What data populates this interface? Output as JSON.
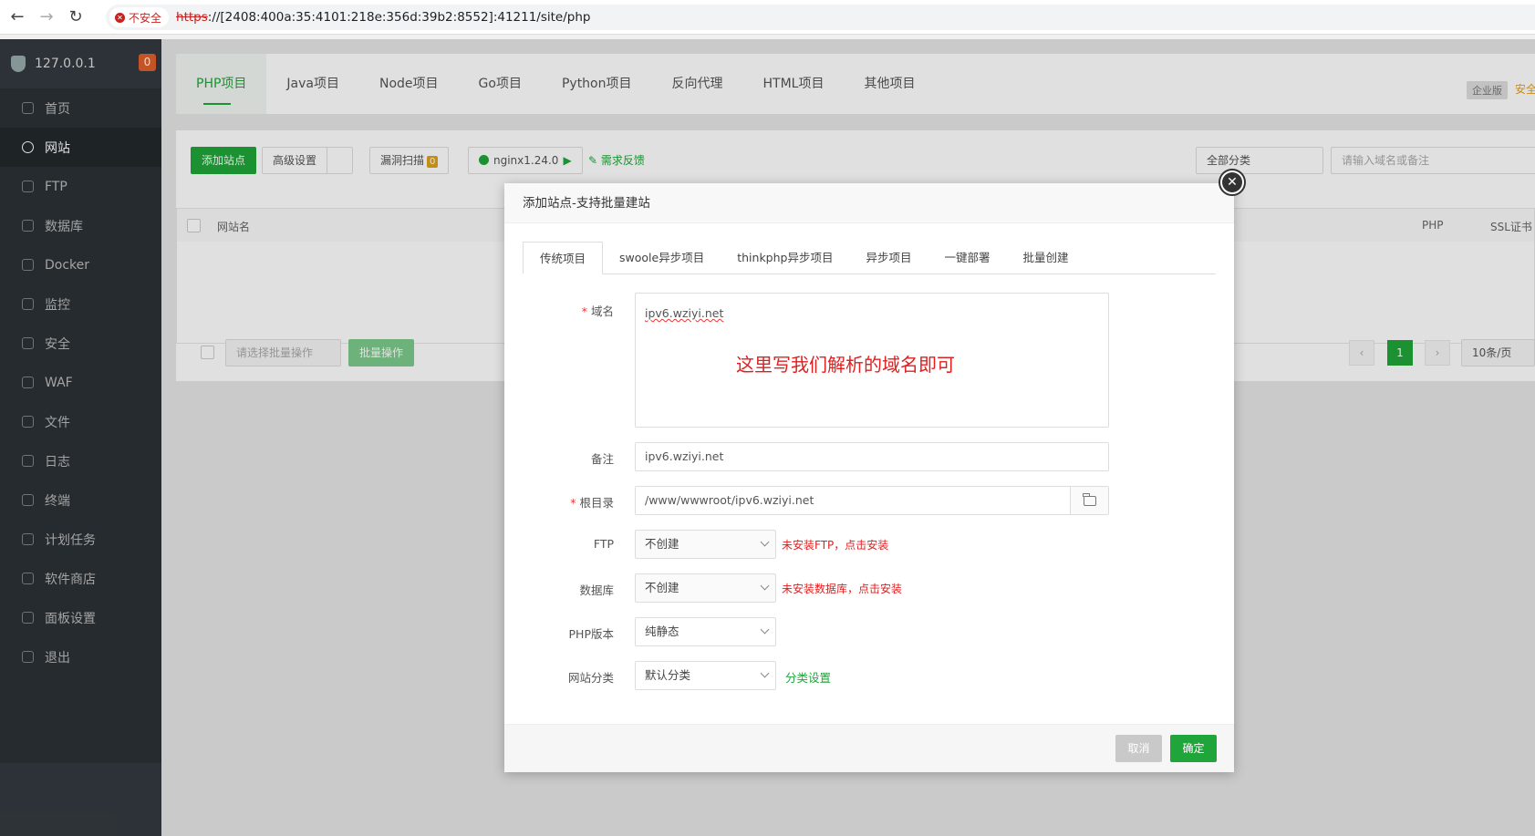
{
  "browser": {
    "url_scheme": "https",
    "url_rest": "://[2408:400a:35:4101:218e:356d:39b2:8552]:41211/site/php",
    "insecure_label": "不安全"
  },
  "sidebar": {
    "host": "127.0.0.1",
    "badge": "0",
    "items": [
      {
        "label": "首页",
        "icon": "home-icon"
      },
      {
        "label": "网站",
        "icon": "globe-icon",
        "active": true
      },
      {
        "label": "FTP",
        "icon": "ftp-icon"
      },
      {
        "label": "数据库",
        "icon": "database-icon"
      },
      {
        "label": "Docker",
        "icon": "docker-icon"
      },
      {
        "label": "监控",
        "icon": "monitor-icon"
      },
      {
        "label": "安全",
        "icon": "shield-icon"
      },
      {
        "label": "WAF",
        "icon": "waf-icon"
      },
      {
        "label": "文件",
        "icon": "folder-icon"
      },
      {
        "label": "日志",
        "icon": "log-icon"
      },
      {
        "label": "终端",
        "icon": "terminal-icon"
      },
      {
        "label": "计划任务",
        "icon": "calendar-icon"
      },
      {
        "label": "软件商店",
        "icon": "store-icon"
      },
      {
        "label": "面板设置",
        "icon": "settings-icon"
      },
      {
        "label": "退出",
        "icon": "logout-icon"
      }
    ]
  },
  "project_tabs": [
    "PHP项目",
    "Java项目",
    "Node项目",
    "Go项目",
    "Python项目",
    "反向代理",
    "HTML项目",
    "其他项目"
  ],
  "enterprise_label": "企业版",
  "enterprise_label2": "安全",
  "toolbar": {
    "add_site": "添加站点",
    "advanced": "高级设置",
    "vuln_scan": "漏洞扫描",
    "vuln_count": "0",
    "nginx": "nginx1.24.0",
    "feedback": "需求反馈",
    "category_select": "全部分类",
    "search_placeholder": "请输入域名或备注"
  },
  "table": {
    "col_site": "网站名",
    "col_php": "PHP",
    "col_ssl": "SSL证书"
  },
  "batch": {
    "select_placeholder": "请选择批量操作",
    "button": "批量操作",
    "page": "1",
    "page_size": "10条/页"
  },
  "modal": {
    "title": "添加站点-支持批量建站",
    "tabs": [
      "传统项目",
      "swoole异步项目",
      "thinkphp异步项目",
      "异步项目",
      "一键部署",
      "批量创建"
    ],
    "domain_label": "域名",
    "domain_value": "ipv6.wziyi.net",
    "annotation": "这里写我们解析的域名即可",
    "note_label": "备注",
    "note_value": "ipv6.wziyi.net",
    "root_label": "根目录",
    "root_value": "/www/wwwroot/ipv6.wziyi.net",
    "ftp_label": "FTP",
    "ftp_value": "不创建",
    "ftp_hint": "未安装FTP，点击安装",
    "db_label": "数据库",
    "db_value": "不创建",
    "db_hint": "未安装数据库，点击安装",
    "php_label": "PHP版本",
    "php_value": "纯静态",
    "category_label": "网站分类",
    "category_value": "默认分类",
    "category_link": "分类设置",
    "cancel": "取消",
    "confirm": "确定"
  }
}
